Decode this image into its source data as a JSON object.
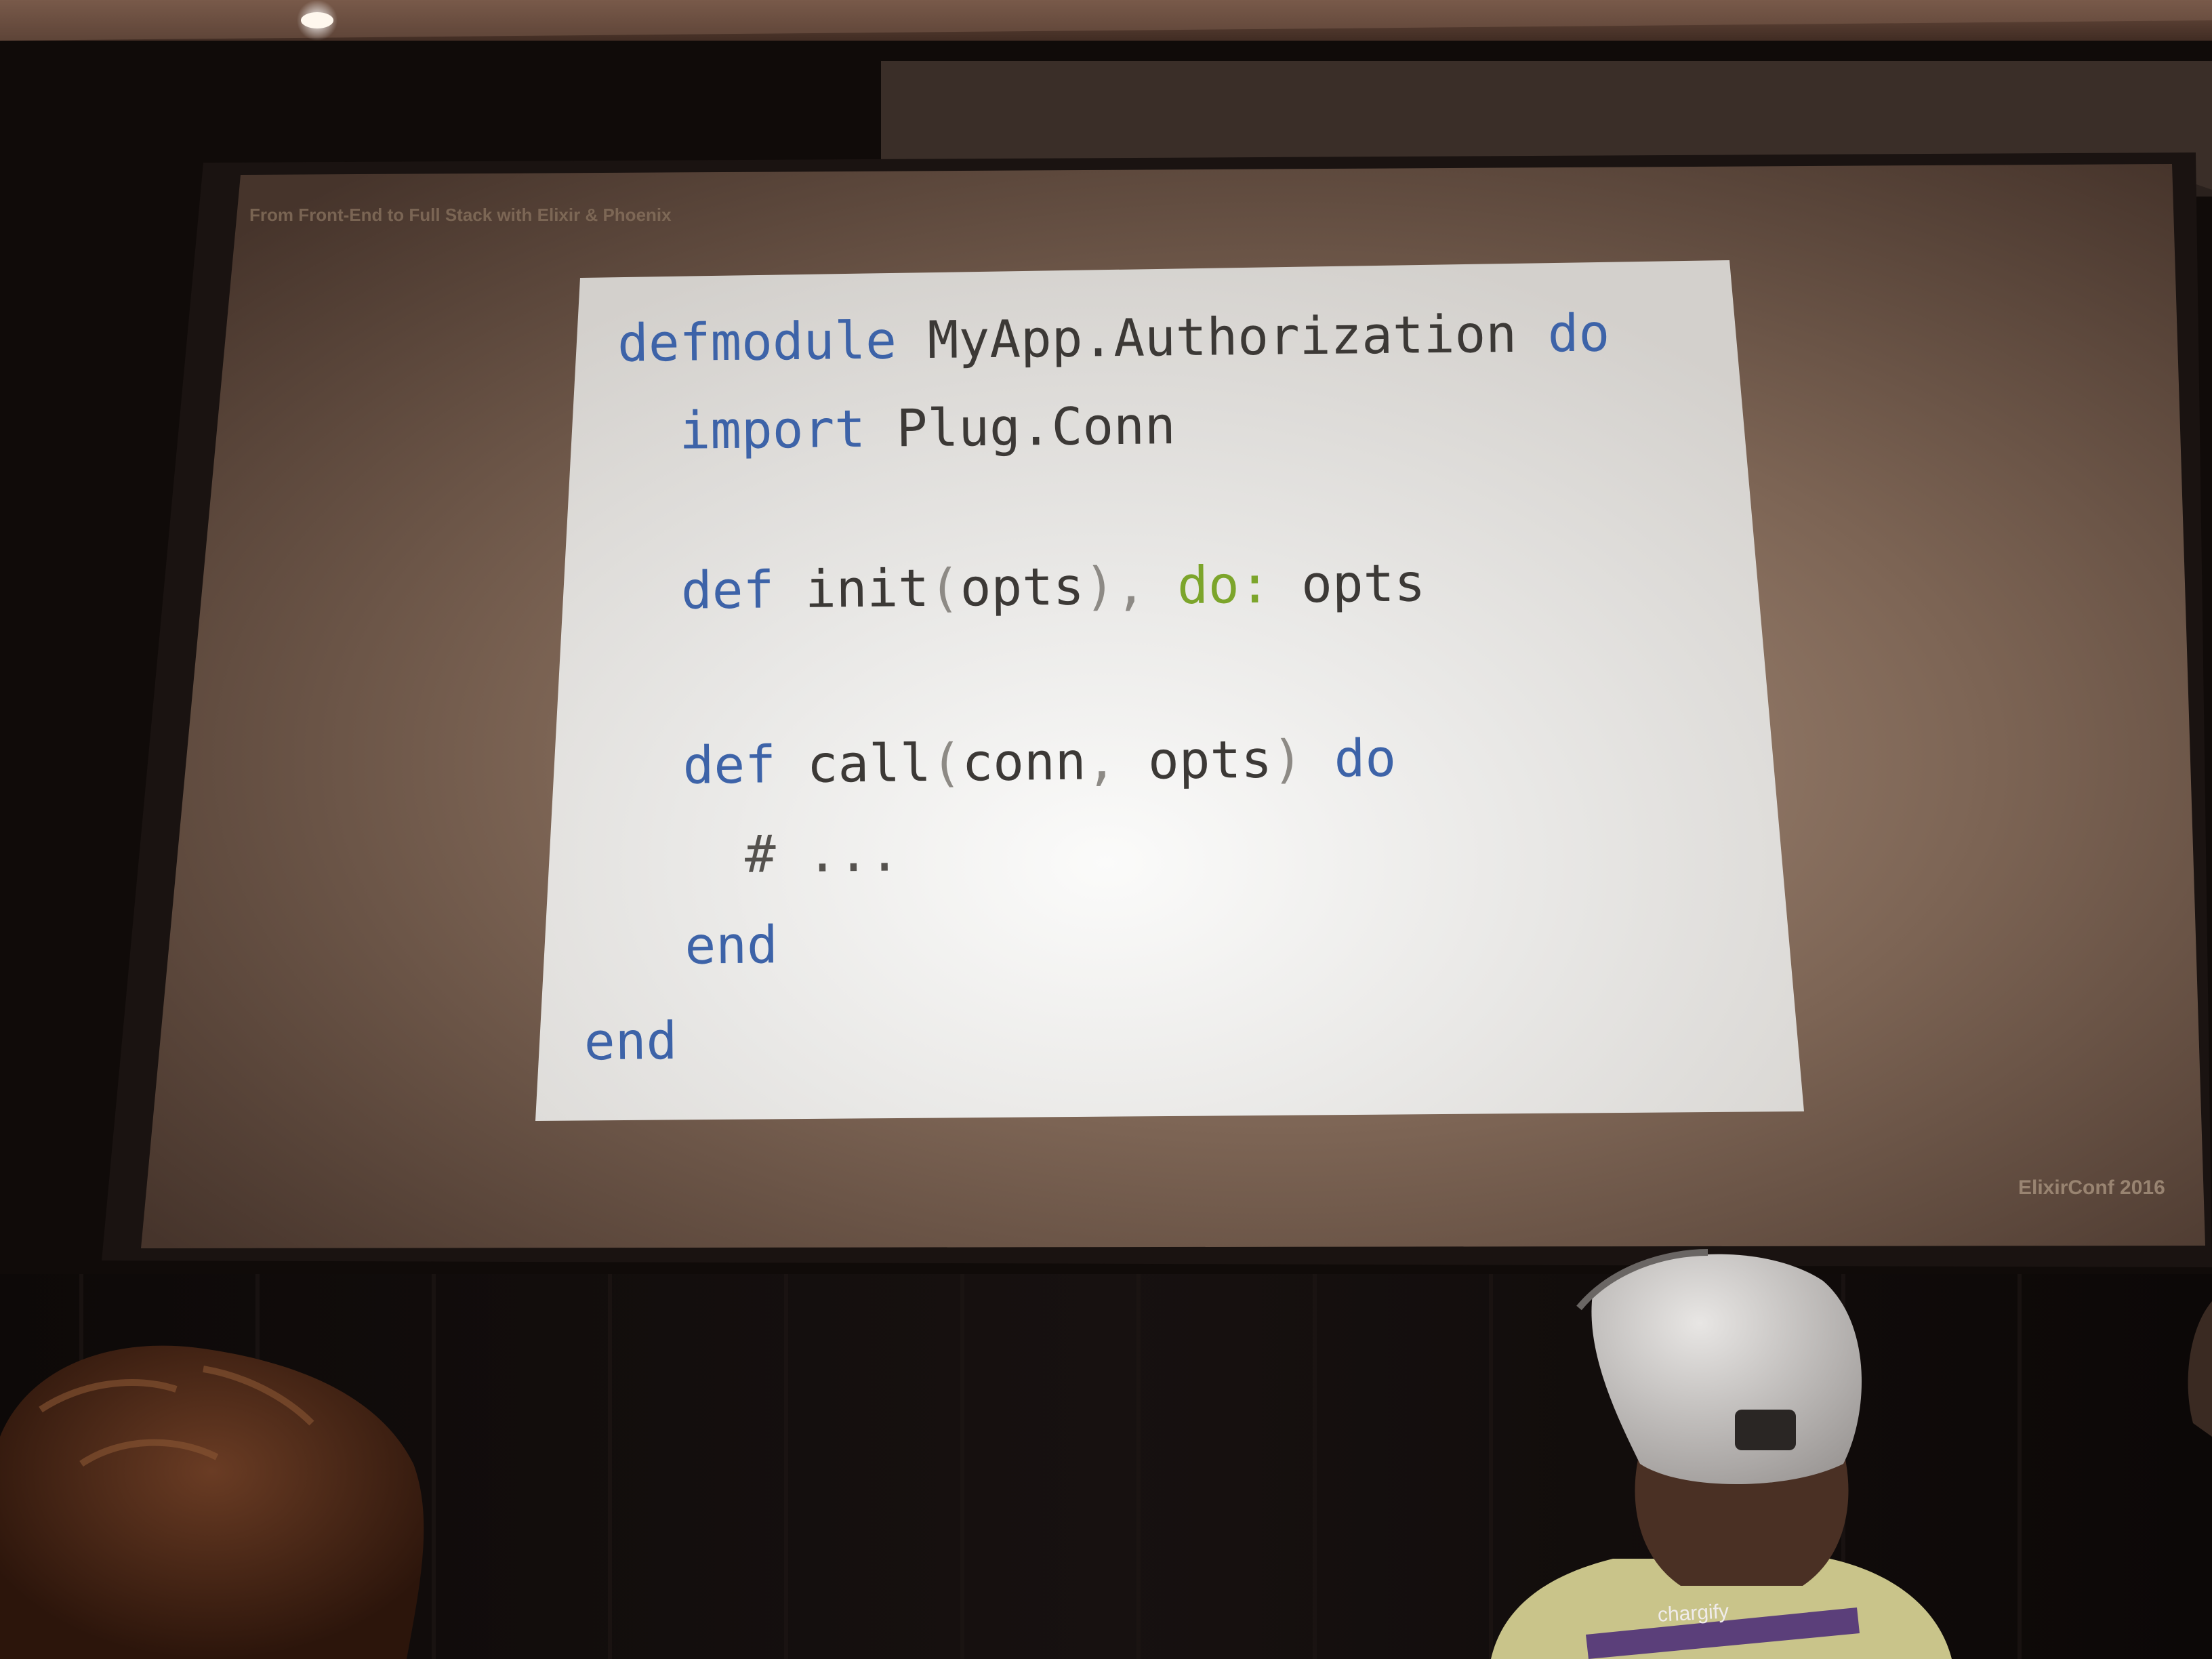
{
  "slide": {
    "header": "From Front-End to Full Stack with Elixir & Phoenix",
    "footer": "ElixirConf 2016",
    "code": {
      "line1": {
        "kw1": "defmodule",
        "name": "MyApp.Authorization",
        "kw2": "do"
      },
      "line2": {
        "kw": "import",
        "name": "Plug.Conn"
      },
      "line3": {
        "kw": "def",
        "fn": "init",
        "open": "(",
        "arg": "opts",
        "close": ")",
        "comma": ",",
        "atom": "do:",
        "value": "opts"
      },
      "line4": {
        "kw": "def",
        "fn": "call",
        "open": "(",
        "arg1": "conn",
        "comma": ",",
        "arg2": "opts",
        "close": ")",
        "kw2": "do"
      },
      "line5": {
        "comment": "# ..."
      },
      "line6": {
        "kw": "end"
      },
      "line7": {
        "kw": "end"
      }
    }
  },
  "lanyard": {
    "text": "chargify"
  },
  "colors": {
    "keyword": "#3d63a8",
    "atom": "#7ca52b",
    "text": "#3c3936",
    "slide_background": "#ece9e3"
  }
}
